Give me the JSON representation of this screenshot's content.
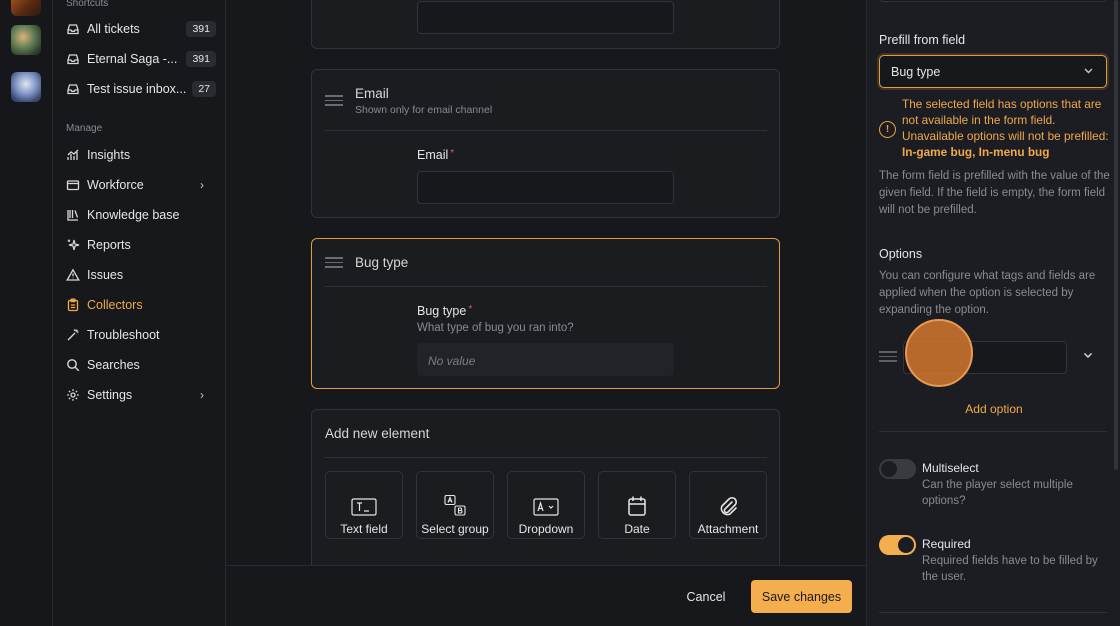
{
  "sidebar": {
    "shortcuts_label": "Shortcuts",
    "manage_label": "Manage",
    "shortcuts": [
      {
        "label": "All tickets",
        "count": "391",
        "icon": "inbox-icon"
      },
      {
        "label": "Eternal Saga -...",
        "count": "391",
        "icon": "inbox-icon"
      },
      {
        "label": "Test issue inbox...",
        "count": "27",
        "icon": "inbox-icon"
      }
    ],
    "manage": [
      {
        "label": "Insights",
        "icon": "chart-icon"
      },
      {
        "label": "Workforce",
        "icon": "workforce-icon"
      },
      {
        "label": "Knowledge base",
        "icon": "book-icon"
      },
      {
        "label": "Reports",
        "icon": "sparkle-icon"
      },
      {
        "label": "Issues",
        "icon": "warning-icon"
      },
      {
        "label": "Collectors",
        "icon": "clipboard-icon"
      },
      {
        "label": "Troubleshoot",
        "icon": "wand-icon"
      },
      {
        "label": "Searches",
        "icon": "search-icon"
      },
      {
        "label": "Settings",
        "icon": "gear-icon"
      }
    ]
  },
  "form": {
    "email_card": {
      "title": "Email",
      "subtitle": "Shown only for email channel",
      "field_label": "Email",
      "required_mark": "*"
    },
    "bug_card": {
      "title": "Bug type",
      "field_label": "Bug type",
      "required_mark": "*",
      "help": "What type of bug you ran into?",
      "value_placeholder": "No value"
    },
    "add_element": {
      "title": "Add new element",
      "tiles": [
        {
          "label": "Text field",
          "icon": "text-field-icon"
        },
        {
          "label": "Select group",
          "icon": "select-group-icon"
        },
        {
          "label": "Dropdown",
          "icon": "dropdown-icon"
        },
        {
          "label": "Date",
          "icon": "calendar-icon"
        },
        {
          "label": "Attachment",
          "icon": "paperclip-icon"
        }
      ]
    }
  },
  "footer": {
    "cancel_label": "Cancel",
    "save_label": "Save changes"
  },
  "panel": {
    "prefill_label": "Prefill from field",
    "prefill_value": "Bug type",
    "warning_text": "The selected field has options that are not available in the form field. Unavailable options will not be prefilled:",
    "warning_options": "In-game bug, In-menu bug",
    "prefill_help": "The form field is prefilled with the value of the given field. If the field is empty, the form field will not be prefilled.",
    "options_label": "Options",
    "options_help": "You can configure what tags and fields are applied when the option is selected by expanding the option.",
    "add_option_label": "Add option",
    "multiselect": {
      "title": "Multiselect",
      "help": "Can the player select multiple options?",
      "enabled": false
    },
    "required": {
      "title": "Required",
      "help": "Required fields have to be filled by the user.",
      "enabled": true
    }
  },
  "colors": {
    "accent": "#f4ae4d",
    "warning": "#f0a94b",
    "background": "#17181c"
  }
}
